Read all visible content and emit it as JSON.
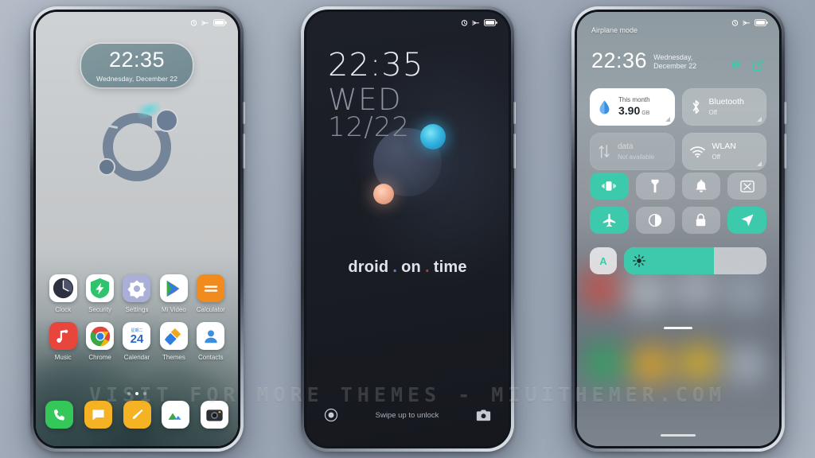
{
  "watermark": "VISIT FOR MORE THEMES - MIUITHEMER.COM",
  "colors": {
    "accent_teal": "#3dc9ac",
    "widget_blue": "#7e969d",
    "logo_blue": "#6c7f96",
    "orb_blue": "#35b6e0",
    "orb_peach": "#efab8e",
    "brand_dot_blue": "#4f86d6",
    "brand_dot_red": "#c0392b"
  },
  "phone1": {
    "name": "home-screen",
    "statusbar": {
      "icons": [
        "alarm-icon",
        "airplane-mode-icon",
        "battery-icon"
      ]
    },
    "clock_widget": {
      "time": "22:35",
      "date": "Wednesday, December 22"
    },
    "logo_widget": {
      "name": "circle-logo-widget"
    },
    "apps": [
      {
        "label": "Clock",
        "icon": "clock-app-icon"
      },
      {
        "label": "Security",
        "icon": "security-app-icon"
      },
      {
        "label": "Settings",
        "icon": "settings-app-icon"
      },
      {
        "label": "Mi Video",
        "icon": "mi-video-app-icon"
      },
      {
        "label": "Calculator",
        "icon": "calculator-app-icon"
      },
      {
        "label": "Music",
        "icon": "music-app-icon"
      },
      {
        "label": "Chrome",
        "icon": "chrome-app-icon"
      },
      {
        "label": "Calendar",
        "icon": "calendar-app-icon"
      },
      {
        "label": "Themes",
        "icon": "themes-app-icon"
      },
      {
        "label": "Contacts",
        "icon": "contacts-app-icon"
      }
    ],
    "calendar_icon": {
      "weekday_cn": "星期二",
      "day": "24"
    },
    "page_dots": {
      "count": 3,
      "active_index": 1
    },
    "dock": [
      {
        "icon": "phone-dock-icon"
      },
      {
        "icon": "messages-dock-icon"
      },
      {
        "icon": "notes-dock-icon"
      },
      {
        "icon": "gallery-dock-icon"
      },
      {
        "icon": "camera-dock-icon"
      }
    ]
  },
  "phone2": {
    "name": "lock-screen",
    "statusbar": {
      "icons": [
        "alarm-icon",
        "airplane-mode-icon",
        "battery-icon"
      ]
    },
    "time": "22:35",
    "weekday": "WED",
    "date": "12/22",
    "brand": {
      "word1": "droid",
      "word2": "on",
      "word3": "time",
      "dot": "."
    },
    "bottom": {
      "left_icon": "voice-assistant-icon",
      "hint": "Swipe up to unlock",
      "right_icon": "camera-icon"
    }
  },
  "phone3": {
    "name": "control-center",
    "statusbar": {
      "icons": [
        "alarm-icon",
        "airplane-mode-icon",
        "battery-icon"
      ]
    },
    "carrier_status": "Airplane mode",
    "time": "22:36",
    "date_line1": "Wednesday,",
    "date_line2": "December 22",
    "header_actions": [
      {
        "icon": "settings-gear-icon"
      },
      {
        "icon": "edit-toggles-icon"
      }
    ],
    "tiles": [
      {
        "name": "data-usage-tile",
        "style": "white",
        "icon": "data-drop-icon",
        "title": "This month",
        "value": "3.90",
        "unit": "GB"
      },
      {
        "name": "bluetooth-tile",
        "style": "normal",
        "icon": "bluetooth-icon",
        "title": "Bluetooth",
        "sub": "Off"
      },
      {
        "name": "mobile-data-tile",
        "style": "dim",
        "icon": "data-arrows-icon",
        "title": "data",
        "sub": "Not available"
      },
      {
        "name": "wlan-tile",
        "style": "normal",
        "icon": "wifi-icon",
        "title": "WLAN",
        "sub": "Off"
      }
    ],
    "toggles": [
      {
        "name": "vibrate-toggle",
        "icon": "vibrate-icon",
        "on": true
      },
      {
        "name": "flashlight-toggle",
        "icon": "flashlight-icon",
        "on": false
      },
      {
        "name": "ringtone-toggle",
        "icon": "bell-icon",
        "on": false
      },
      {
        "name": "screenshot-toggle",
        "icon": "screenshot-icon",
        "on": false
      },
      {
        "name": "airplane-toggle",
        "icon": "airplane-icon",
        "on": true
      },
      {
        "name": "darkmode-toggle",
        "icon": "dark-mode-icon",
        "on": false
      },
      {
        "name": "lock-toggle",
        "icon": "lock-icon",
        "on": false
      },
      {
        "name": "location-toggle",
        "icon": "location-icon",
        "on": true
      }
    ],
    "brightness": {
      "auto_label": "A",
      "percent": 63,
      "icon": "brightness-icon"
    }
  }
}
